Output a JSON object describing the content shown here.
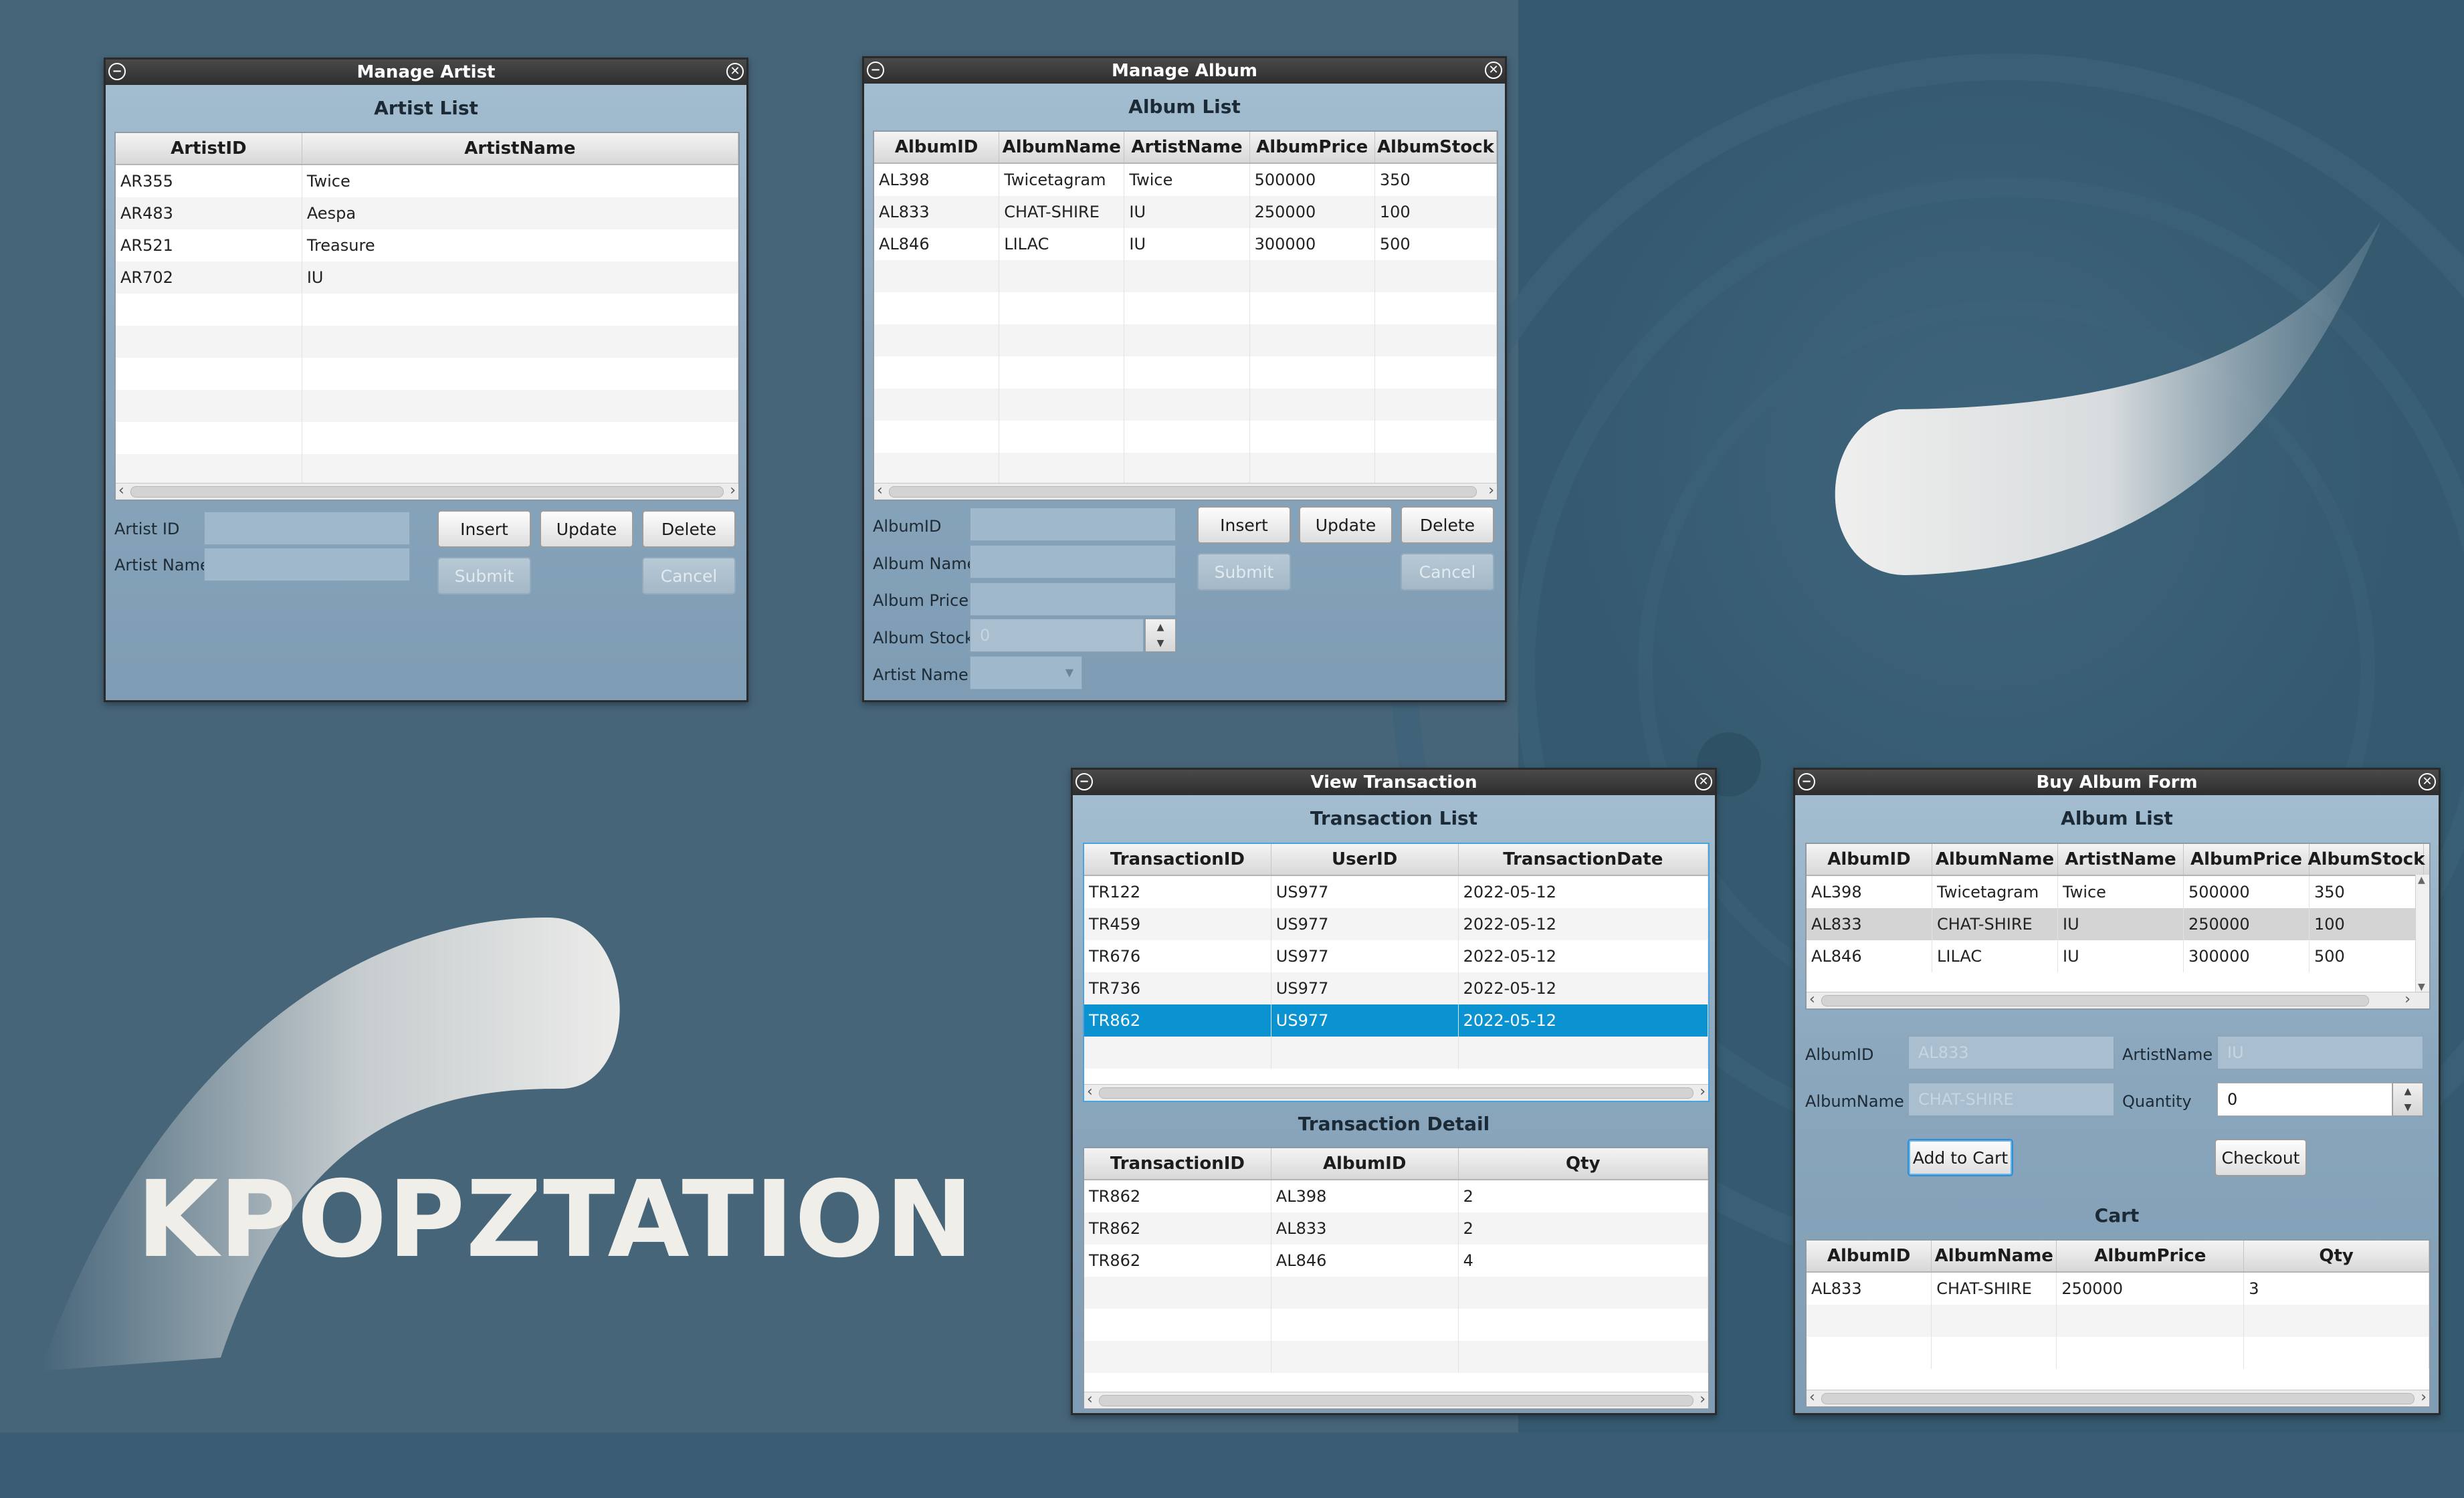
{
  "brand": "KPOPZTATION",
  "manage_artist": {
    "title": "Manage Artist",
    "list_title": "Artist List",
    "columns": [
      "ArtistID",
      "ArtistName"
    ],
    "rows": [
      [
        "AR355",
        "Twice"
      ],
      [
        "AR483",
        "Aespa"
      ],
      [
        "AR521",
        "Treasure"
      ],
      [
        "AR702",
        "IU"
      ]
    ],
    "labels": {
      "artist_id": "Artist ID",
      "artist_name": "Artist Name"
    },
    "buttons": {
      "insert": "Insert",
      "update": "Update",
      "delete": "Delete",
      "submit": "Submit",
      "cancel": "Cancel"
    }
  },
  "manage_album": {
    "title": "Manage Album",
    "list_title": "Album List",
    "columns": [
      "AlbumID",
      "AlbumName",
      "ArtistName",
      "AlbumPrice",
      "AlbumStock"
    ],
    "rows": [
      [
        "AL398",
        "Twicetagram",
        "Twice",
        "500000",
        "350"
      ],
      [
        "AL833",
        "CHAT-SHIRE",
        "IU",
        "250000",
        "100"
      ],
      [
        "AL846",
        "LILAC",
        "IU",
        "300000",
        "500"
      ]
    ],
    "labels": {
      "album_id": "AlbumID",
      "album_name": "Album Name",
      "album_price": "Album Price",
      "album_stock": "Album Stock",
      "artist_name": "Artist Name"
    },
    "stock_value": "0",
    "buttons": {
      "insert": "Insert",
      "update": "Update",
      "delete": "Delete",
      "submit": "Submit",
      "cancel": "Cancel"
    }
  },
  "view_transaction": {
    "title": "View Transaction",
    "list_title": "Transaction List",
    "columns": [
      "TransactionID",
      "UserID",
      "TransactionDate"
    ],
    "rows": [
      [
        "TR122",
        "US977",
        "2022-05-12"
      ],
      [
        "TR459",
        "US977",
        "2022-05-12"
      ],
      [
        "TR676",
        "US977",
        "2022-05-12"
      ],
      [
        "TR736",
        "US977",
        "2022-05-12"
      ],
      [
        "TR862",
        "US977",
        "2022-05-12"
      ]
    ],
    "selected_row": 4,
    "detail_title": "Transaction Detail",
    "detail_columns": [
      "TransactionID",
      "AlbumID",
      "Qty"
    ],
    "detail_rows": [
      [
        "TR862",
        "AL398",
        "2"
      ],
      [
        "TR862",
        "AL833",
        "2"
      ],
      [
        "TR862",
        "AL846",
        "4"
      ]
    ]
  },
  "buy_album": {
    "title": "Buy Album Form",
    "list_title": "Album List",
    "columns": [
      "AlbumID",
      "AlbumName",
      "ArtistName",
      "AlbumPrice",
      "AlbumStock"
    ],
    "rows": [
      [
        "AL398",
        "Twicetagram",
        "Twice",
        "500000",
        "350"
      ],
      [
        "AL833",
        "CHAT-SHIRE",
        "IU",
        "250000",
        "100"
      ],
      [
        "AL846",
        "LILAC",
        "IU",
        "300000",
        "500"
      ]
    ],
    "highlighted_row": 1,
    "labels": {
      "album_id": "AlbumID",
      "album_name": "AlbumName",
      "artist_name": "ArtistName",
      "quantity": "Quantity"
    },
    "values": {
      "album_id": "AL833",
      "album_name": "CHAT-SHIRE",
      "artist_name": "IU",
      "quantity": "0"
    },
    "buttons": {
      "add_to_cart": "Add to Cart",
      "checkout": "Checkout"
    },
    "cart_title": "Cart",
    "cart_columns": [
      "AlbumID",
      "AlbumName",
      "AlbumPrice",
      "Qty"
    ],
    "cart_rows": [
      [
        "AL833",
        "CHAT-SHIRE",
        "250000",
        "3"
      ]
    ]
  },
  "colors": {
    "accent_selected": "#0a93d0",
    "brand_text": "#f0eee8",
    "background": "#466579"
  }
}
